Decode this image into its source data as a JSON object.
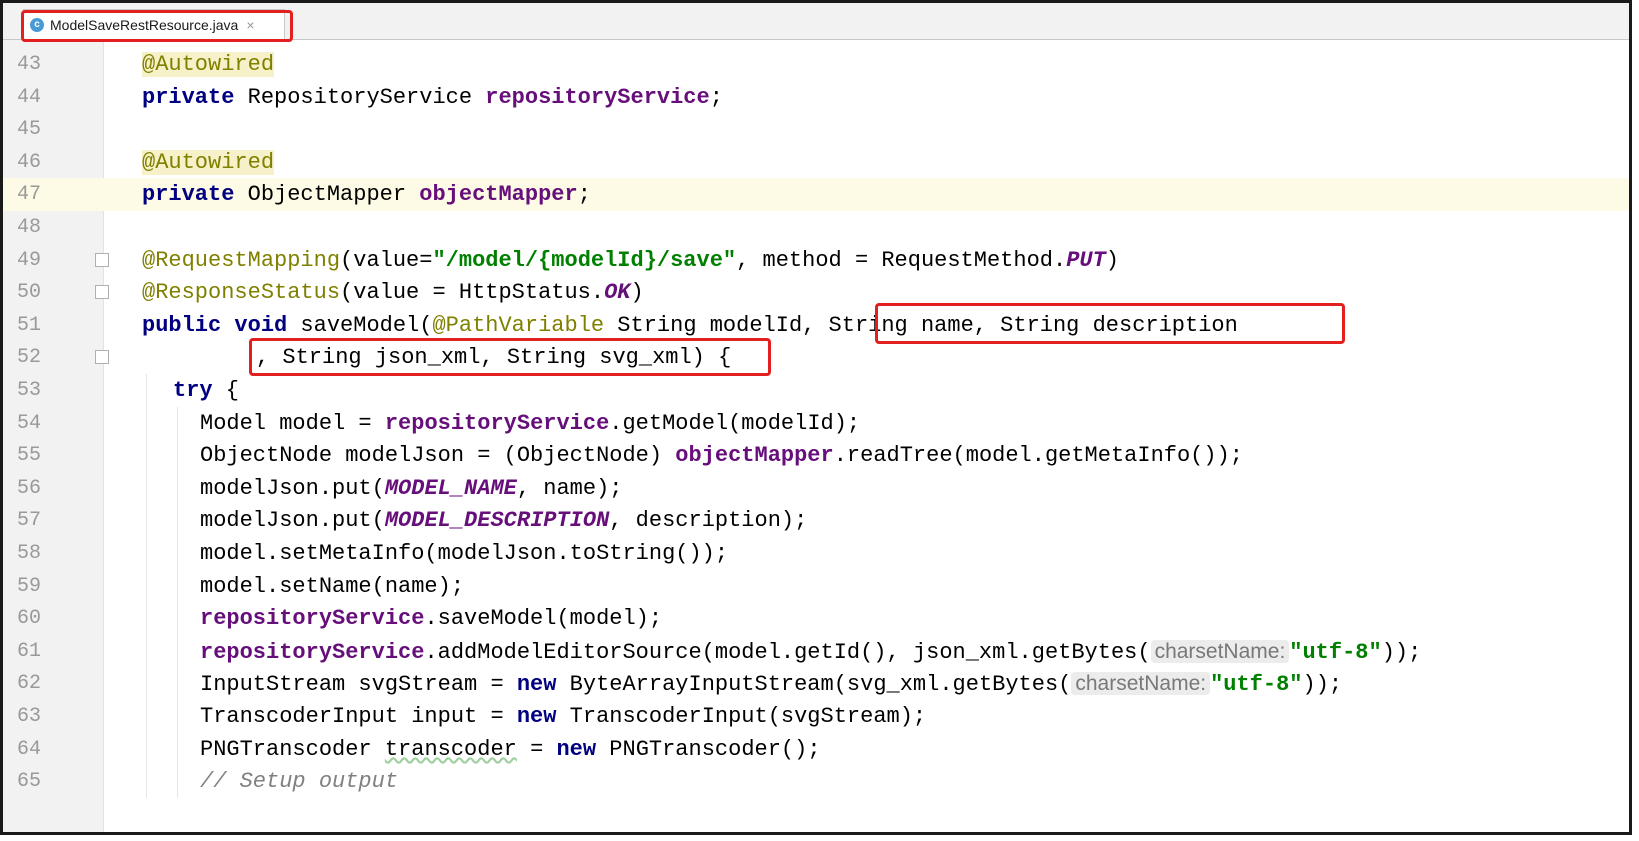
{
  "tab": {
    "filename": "ModelSaveRestResource.java",
    "icon": "java-class-icon",
    "close_glyph": "×"
  },
  "highlight_color": "#e32020",
  "lines": [
    {
      "num": "43",
      "code": "@Autowired"
    },
    {
      "num": "44",
      "code": "private RepositoryService repositoryService;"
    },
    {
      "num": "45",
      "code": ""
    },
    {
      "num": "46",
      "code": "@Autowired"
    },
    {
      "num": "47",
      "code": "private ObjectMapper objectMapper;"
    },
    {
      "num": "48",
      "code": ""
    },
    {
      "num": "49",
      "code": "@RequestMapping(value=\"/model/{modelId}/save\", method = RequestMethod.PUT)"
    },
    {
      "num": "50",
      "code": "@ResponseStatus(value = HttpStatus.OK)"
    },
    {
      "num": "51",
      "code": "public void saveModel(@PathVariable String modelId, String name, String description"
    },
    {
      "num": "52",
      "code": ", String json_xml, String svg_xml) {"
    },
    {
      "num": "53",
      "code": "try {"
    },
    {
      "num": "54",
      "code": "Model model = repositoryService.getModel(modelId);"
    },
    {
      "num": "55",
      "code": "ObjectNode modelJson = (ObjectNode) objectMapper.readTree(model.getMetaInfo());"
    },
    {
      "num": "56",
      "code": "modelJson.put(MODEL_NAME, name);"
    },
    {
      "num": "57",
      "code": "modelJson.put(MODEL_DESCRIPTION, description);"
    },
    {
      "num": "58",
      "code": "model.setMetaInfo(modelJson.toString());"
    },
    {
      "num": "59",
      "code": "model.setName(name);"
    },
    {
      "num": "60",
      "code": "repositoryService.saveModel(model);"
    },
    {
      "num": "61",
      "code": "repositoryService.addModelEditorSource(model.getId(), json_xml.getBytes( charsetName: \"utf-8\"));"
    },
    {
      "num": "62",
      "code": "InputStream svgStream = new ByteArrayInputStream(svg_xml.getBytes( charsetName: \"utf-8\"));"
    },
    {
      "num": "63",
      "code": "TranscoderInput input = new TranscoderInput(svgStream);"
    },
    {
      "num": "64",
      "code": "PNGTranscoder transcoder = new PNGTranscoder();"
    },
    {
      "num": "65",
      "code": "// Setup output"
    }
  ],
  "current_line": "47"
}
